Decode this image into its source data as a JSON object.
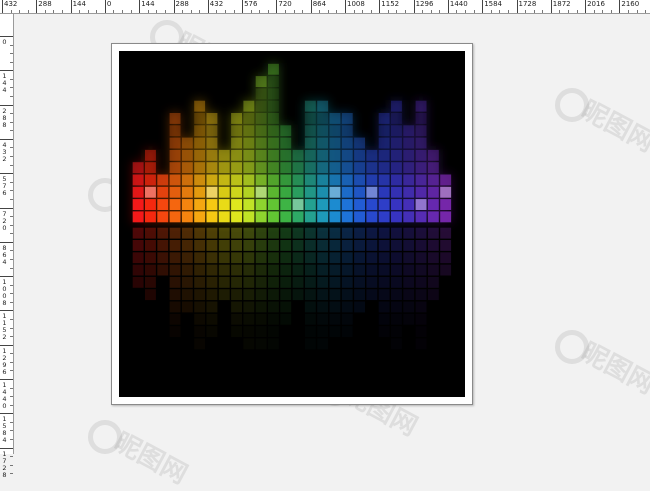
{
  "rulers": {
    "top_labels": [
      "432",
      "288",
      "144",
      "0",
      "144",
      "288",
      "432",
      "576",
      "720",
      "864",
      "1008",
      "1152",
      "1296",
      "1440",
      "1584",
      "1728",
      "1872",
      "2016",
      "2160"
    ],
    "left_labels": [
      "0",
      "144",
      "288",
      "432",
      "576",
      "720",
      "864",
      "1008",
      "1152",
      "1296",
      "1440",
      "1584",
      "1728"
    ]
  },
  "watermark": {
    "text": "昵图网",
    "color": "#969696",
    "icon": "watermark-logo-icon"
  },
  "artwork": {
    "background": "#000000",
    "frame_color": "#ffffff",
    "columns": [
      {
        "h": 5,
        "color": "#ff1a1a"
      },
      {
        "h": 6,
        "color": "#ff2a10"
      },
      {
        "h": 4,
        "color": "#ff4a10"
      },
      {
        "h": 9,
        "color": "#ff6a10"
      },
      {
        "h": 7,
        "color": "#ff8a10"
      },
      {
        "h": 10,
        "color": "#ffae12"
      },
      {
        "h": 9,
        "color": "#ffd014"
      },
      {
        "h": 6,
        "color": "#f2e418"
      },
      {
        "h": 9,
        "color": "#e8f020"
      },
      {
        "h": 10,
        "color": "#c8ec28"
      },
      {
        "h": 12,
        "color": "#94dc30"
      },
      {
        "h": 13,
        "color": "#66cc36"
      },
      {
        "h": 8,
        "color": "#40bc48"
      },
      {
        "h": 6,
        "color": "#30b06a"
      },
      {
        "h": 10,
        "color": "#26a896"
      },
      {
        "h": 10,
        "color": "#20a0c2"
      },
      {
        "h": 9,
        "color": "#1e90d8"
      },
      {
        "h": 9,
        "color": "#2078e0"
      },
      {
        "h": 7,
        "color": "#2460dc"
      },
      {
        "h": 6,
        "color": "#2a4cd6"
      },
      {
        "h": 9,
        "color": "#3040d0"
      },
      {
        "h": 10,
        "color": "#3a36c8"
      },
      {
        "h": 8,
        "color": "#4832c0"
      },
      {
        "h": 10,
        "color": "#5a2ebc"
      },
      {
        "h": 6,
        "color": "#6a2ab6"
      },
      {
        "h": 4,
        "color": "#7a28b0"
      }
    ]
  }
}
